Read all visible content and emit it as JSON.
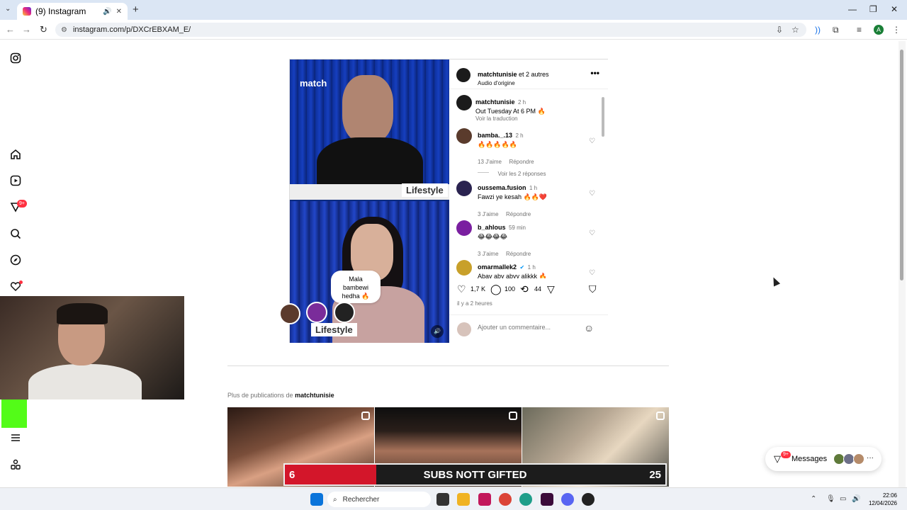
{
  "browser": {
    "tab_title": "(9) Instagram",
    "url": "instagram.com/p/DXCrEBXAM_E/"
  },
  "rail": {
    "notifications_badge": "9+"
  },
  "post": {
    "overlay_brand": "match",
    "overlay_tag_top": "Lifestyle",
    "overlay_tag_bottom": "Lifestyle",
    "bubble_line1": "Mala",
    "bubble_line2": "bambewi",
    "bubble_line3": "hedha 🔥",
    "header": {
      "author": "matchtunisie",
      "coauthors": " et 2 autres",
      "audio": "Audio d'origine"
    },
    "caption": {
      "author": "matchtunisie",
      "time": "2 h",
      "text": "Out Tuesday At 6 PM 🔥",
      "translate": "Voir la traduction"
    },
    "comments": [
      {
        "user": "bamba._.13",
        "time": "2 h",
        "text": "🔥🔥🔥🔥🔥",
        "likes": "13 J'aime",
        "reply": "Répondre",
        "avatar_color": "#5a3b2c"
      },
      {
        "user": "oussema.fusion",
        "time": "1 h",
        "text": "Fawzi ye kesah 🔥🔥❤️",
        "likes": "3 J'aime",
        "reply": "Répondre",
        "avatar_color": "#2a2350"
      },
      {
        "user": "b_ahlous",
        "time": "59 min",
        "text": "😂😂😂😂",
        "likes": "3 J'aime",
        "reply": "Répondre",
        "avatar_color": "#7a1fa0"
      },
      {
        "user": "omarmallek2",
        "time": "1 h",
        "text": "Abay aby abyy alikkk 🔥",
        "likes": "",
        "reply": "",
        "avatar_color": "#c8a02a"
      }
    ],
    "view_replies": "Voir les 2 réponses",
    "likes_count": "1,7 K",
    "comments_count": "100",
    "reposts_count": "44",
    "posted_ago": "il y a 2 heures",
    "comment_placeholder": "Ajouter un commentaire..."
  },
  "more_posts": {
    "prefix": "Plus de publications de ",
    "author": "matchtunisie"
  },
  "subs_goal": {
    "current": "6",
    "label": "SUBS NOTT GIFTED",
    "target": "25",
    "progress_fraction": 0.24
  },
  "messages": {
    "label": "Messages",
    "badge": "9+"
  },
  "taskbar": {
    "search": "Rechercher",
    "time": "22:06",
    "date": "12/04/2026"
  },
  "colors": {
    "accent_red": "#ff3040",
    "verified_blue": "#0095f6",
    "subs_red": "#d3162a"
  }
}
